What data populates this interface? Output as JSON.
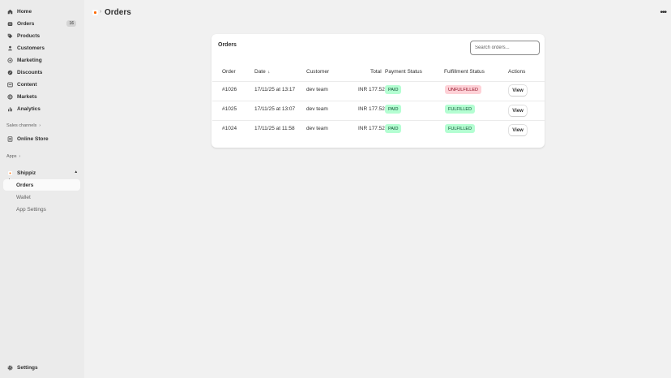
{
  "sidebar": {
    "items": [
      {
        "label": "Home",
        "icon": "home-icon"
      },
      {
        "label": "Orders",
        "icon": "orders-icon",
        "count": "16"
      },
      {
        "label": "Products",
        "icon": "tag-icon"
      },
      {
        "label": "Customers",
        "icon": "person-icon"
      },
      {
        "label": "Marketing",
        "icon": "target-icon"
      },
      {
        "label": "Discounts",
        "icon": "discount-icon"
      },
      {
        "label": "Content",
        "icon": "content-icon"
      },
      {
        "label": "Markets",
        "icon": "globe-icon"
      },
      {
        "label": "Analytics",
        "icon": "bar-chart-icon"
      }
    ],
    "sales_channels_label": "Sales channels",
    "online_store_label": "Online Store",
    "apps_label": "Apps",
    "app_name": "Shippiz",
    "app_subitems": [
      "Orders",
      "Wallet",
      "App Settings"
    ],
    "settings_label": "Settings"
  },
  "header": {
    "title": "Orders",
    "more_label": "•••"
  },
  "card": {
    "title": "Orders",
    "search_placeholder": "Search orders...",
    "columns": {
      "order": "Order",
      "date": "Date",
      "sort_arrow": "↓",
      "customer": "Customer",
      "total": "Total",
      "payment": "Payment Status",
      "fulfillment": "Fulfillment Status",
      "actions": "Actions"
    },
    "rows": [
      {
        "order": "#1026",
        "date": "17/11/25 at 13:17",
        "customer": "dev team",
        "total": "INR 177.52",
        "payment": "PAID",
        "fulfillment": "UNFULFILLED",
        "action": "View"
      },
      {
        "order": "#1025",
        "date": "17/11/25 at 13:07",
        "customer": "dev team",
        "total": "INR 177.52",
        "payment": "PAID",
        "fulfillment": "FULFILLED",
        "action": "View"
      },
      {
        "order": "#1024",
        "date": "17/11/25 at 11:58",
        "customer": "dev team",
        "total": "INR 177.52",
        "payment": "PAID",
        "fulfillment": "FULFILLED",
        "action": "View"
      }
    ]
  },
  "colors": {
    "paid_bg": "#b4fed2",
    "unfulfilled_bg": "#fed1d7",
    "accent": "#ff6a00"
  }
}
